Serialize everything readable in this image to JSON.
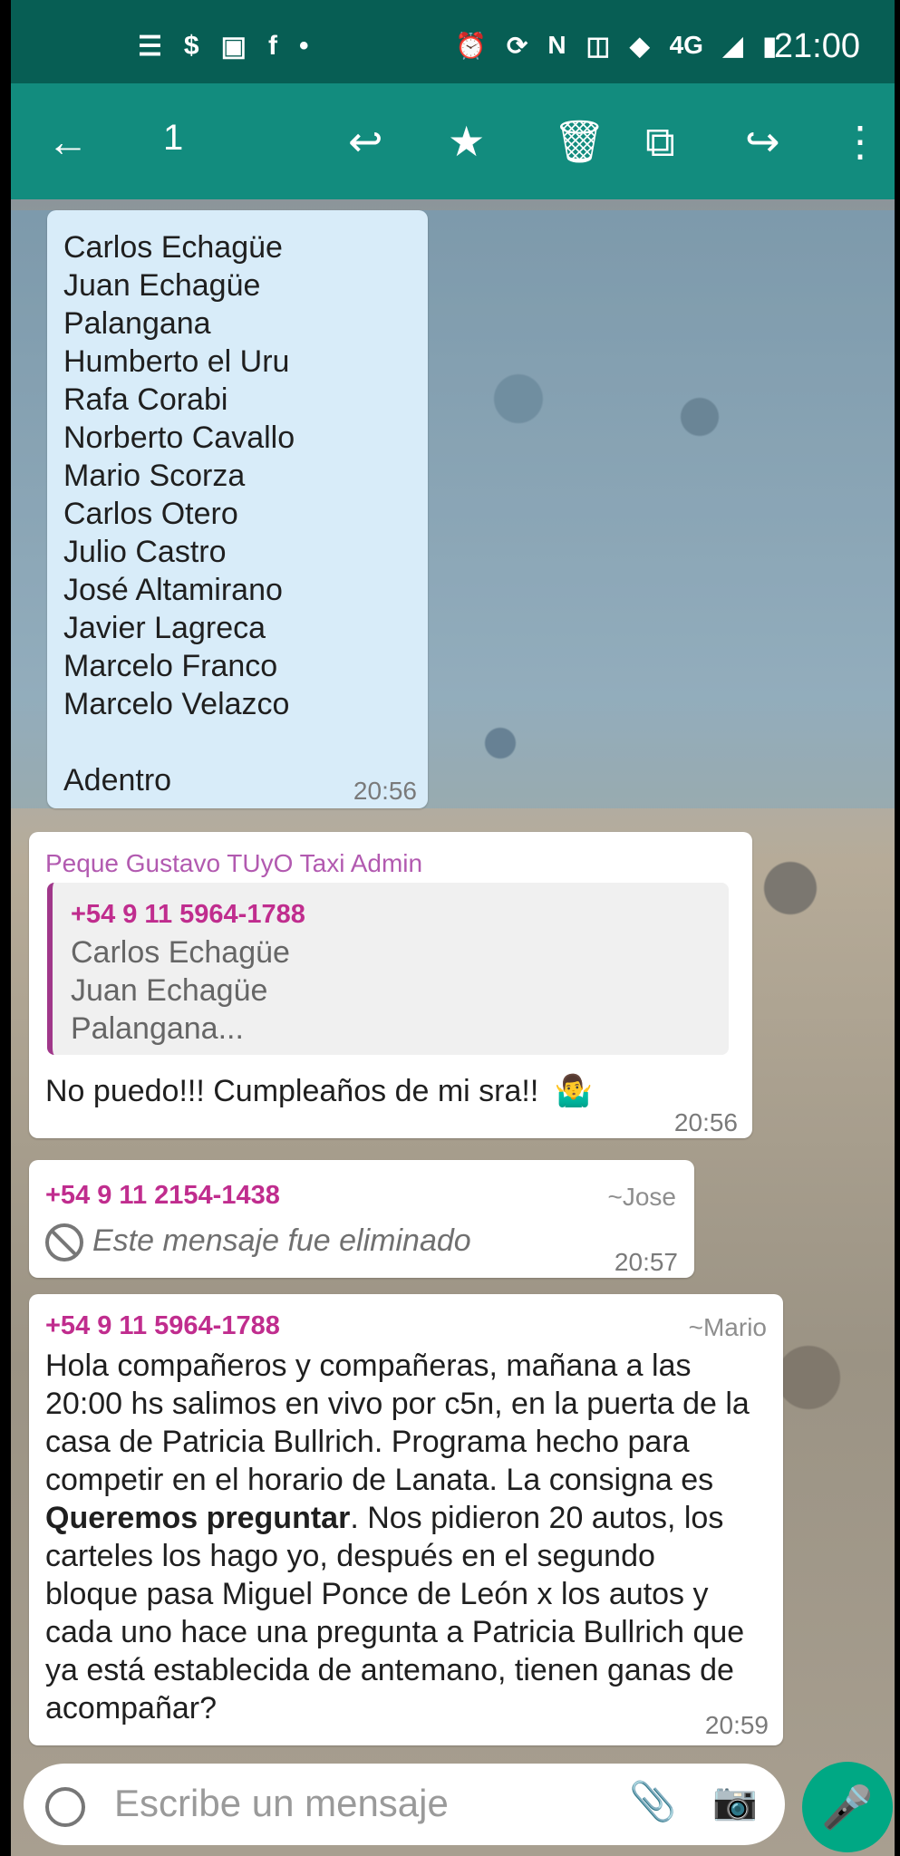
{
  "status_bar": {
    "time": "21:00",
    "left_icons": [
      "menu-icon",
      "dollar-icon",
      "photo-icon",
      "facebook-icon",
      "dot-icon"
    ],
    "right_icons": [
      "alarm-icon",
      "sync-icon",
      "nfc-icon",
      "vibrate-icon",
      "wifi-icon",
      "lte-icon",
      "signal-icon",
      "battery-icon"
    ],
    "network_label": "4G"
  },
  "appbar": {
    "count": "1"
  },
  "messages": {
    "selected": {
      "lines": [
        "Carlos Echagüe",
        "Juan Echagüe",
        "Palangana",
        "Humberto el Uru",
        "Rafa Corabi",
        "Norberto Cavallo",
        "Mario Scorza",
        "Carlos Otero",
        "Julio Castro",
        "José Altamirano",
        "Javier Lagreca",
        "Marcelo Franco",
        "Marcelo Velazco",
        "",
        "Adentro"
      ],
      "time": "20:56"
    },
    "reply": {
      "sender": "Peque Gustavo TUyO Taxi Admin",
      "quoted_number": "+54 9 11 5964-1788",
      "quoted_lines": [
        "Carlos Echagüe",
        "Juan Echagüe",
        "Palangana..."
      ],
      "text": "No puedo!!! Cumpleaños de mi sra!!",
      "emoji": "🤷‍♂️",
      "time": "20:56"
    },
    "deleted": {
      "number": "+54 9 11 2154-1438",
      "name": "~Jose",
      "text": "Este mensaje fue eliminado",
      "time": "20:57"
    },
    "long": {
      "number": "+54 9 11 5964-1788",
      "name": "~Mario",
      "text_before": "Hola compañeros y compañeras, mañana a las 20:00 hs salimos en vivo por c5n, en la puerta de la casa de Patricia Bullrich. Programa hecho para competir en el horario de Lanata. La consigna es ",
      "text_bold": "Queremos preguntar",
      "text_after": ". Nos pidieron 20 autos, los carteles los hago yo, después en el segundo bloque pasa Miguel Ponce de León x los autos y cada uno hace una pregunta a Patricia Bullrich que ya está establecida de antemano, tienen ganas de acompañar?",
      "time": "20:59"
    }
  },
  "input": {
    "placeholder": "Escribe un mensaje"
  }
}
